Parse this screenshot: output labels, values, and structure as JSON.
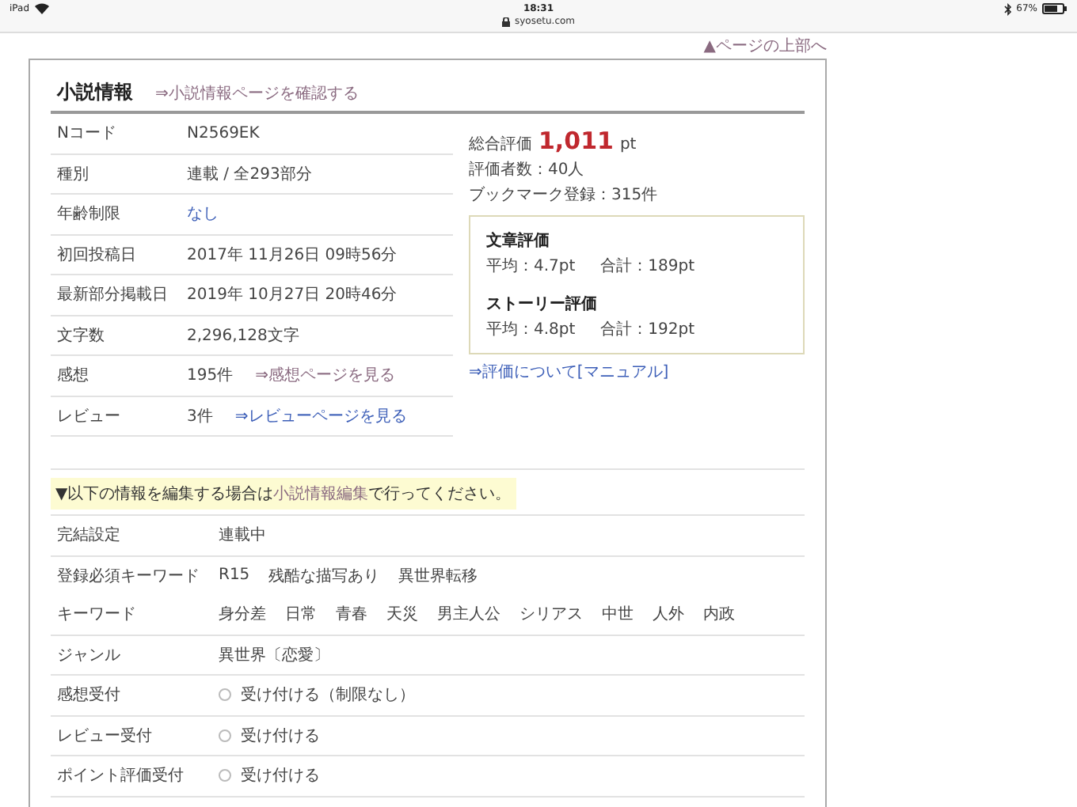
{
  "status_bar": {
    "device": "iPad",
    "time": "18:31",
    "url": "syosetu.com",
    "battery": "67%"
  },
  "page_top_link": "▲ページの上部へ",
  "section": {
    "title": "小説情報",
    "link": "⇒小説情報ページを確認する"
  },
  "info_rows": [
    {
      "label": "Nコード",
      "parts": [
        {
          "kind": "text",
          "text": "N2569EK"
        }
      ]
    },
    {
      "label": "種別",
      "parts": [
        {
          "kind": "text",
          "text": "連載 / 全293部分"
        }
      ]
    },
    {
      "label": "年齢制限",
      "parts": [
        {
          "kind": "link",
          "text": "なし"
        }
      ]
    },
    {
      "label": "初回投稿日",
      "parts": [
        {
          "kind": "text",
          "text": "2017年 11月26日 09時56分"
        }
      ]
    },
    {
      "label": "最新部分掲載日",
      "parts": [
        {
          "kind": "text",
          "text": "2019年 10月27日 20時46分"
        }
      ]
    },
    {
      "label": "文字数",
      "parts": [
        {
          "kind": "text",
          "text": "2,296,128文字"
        }
      ]
    },
    {
      "label": "感想",
      "parts": [
        {
          "kind": "text",
          "text": "195件"
        },
        {
          "kind": "visited_link",
          "text": "⇒感想ページを見る"
        }
      ]
    },
    {
      "label": "レビュー",
      "parts": [
        {
          "kind": "text",
          "text": "3件"
        },
        {
          "kind": "link",
          "text": "⇒レビューページを見る"
        }
      ]
    }
  ],
  "rating": {
    "total_label": "総合評価",
    "total": "1,011",
    "unit": "pt",
    "raters": "評価者数：40人",
    "bookmarks": "ブックマーク登録：315件",
    "breakdown": [
      {
        "title": "文章評価",
        "average": "平均：4.7pt",
        "sum": "合計：189pt"
      },
      {
        "title": "ストーリー評価",
        "average": "平均：4.8pt",
        "sum": "合計：192pt"
      }
    ],
    "manual_link": "⇒評価について[マニュアル]"
  },
  "notice": {
    "before": "▼以下の情報を編集する場合は",
    "link": "小説情報編集",
    "after": "で行ってください。"
  },
  "settings_rows": [
    {
      "kind": "text",
      "label": "完結設定",
      "value": "連載中"
    },
    {
      "kind": "tags",
      "label": "登録必須キーワード",
      "tags": [
        "R15",
        "残酷な描写あり",
        "異世界転移"
      ]
    },
    {
      "kind": "tags",
      "label": "キーワード",
      "tags": [
        "身分差",
        "日常",
        "青春",
        "天災",
        "男主人公",
        "シリアス",
        "中世",
        "人外",
        "内政"
      ]
    },
    {
      "kind": "text",
      "label": "ジャンル",
      "value": "異世界〔恋愛〕"
    },
    {
      "kind": "radio",
      "label": "感想受付",
      "value": "受け付ける（制限なし）",
      "checked": false
    },
    {
      "kind": "radio",
      "label": "レビュー受付",
      "value": "受け付ける",
      "checked": false
    },
    {
      "kind": "radio",
      "label": "ポイント評価受付",
      "value": "受け付ける",
      "checked": false
    }
  ]
}
